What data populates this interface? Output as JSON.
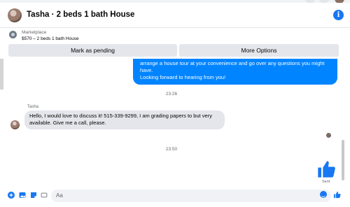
{
  "header": {
    "title": "Tasha · 2 beds 1 bath House",
    "info_icon": "i"
  },
  "marketplace": {
    "label": "Marketplace",
    "item": "$570 – 2 beds 1 bath House",
    "mark_pending_label": "Mark as pending",
    "more_options_label": "More Options"
  },
  "messages": {
    "sent_line2": "arrange a house tour at your convenience and go over any questions you might",
    "sent_line3": "have.",
    "sent_line4": "Looking forward to hearing from you!",
    "time1": "23:26",
    "sender_name": "Tasha",
    "received_line1": "Hello, I would love to discuss it! 515-339-9299, I am grading papers to but very",
    "received_line2": "available. Give me a call, please.",
    "time2": "23:50",
    "sent_status": "Sent"
  },
  "composer": {
    "placeholder": "Aa"
  },
  "colors": {
    "accent": "#0084ff",
    "brand": "#1877f2",
    "bubble_received": "#e4e6eb"
  }
}
